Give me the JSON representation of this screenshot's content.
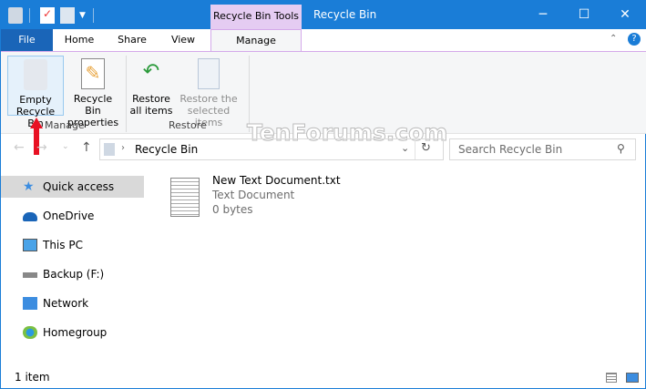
{
  "titlebar": {
    "context_tab": "Recycle Bin Tools",
    "title": "Recycle Bin",
    "minimize": "─",
    "maximize": "☐",
    "close": "✕"
  },
  "tabs": {
    "file": "File",
    "home": "Home",
    "share": "Share",
    "view": "View",
    "manage": "Manage"
  },
  "ribbon": {
    "empty_l1": "Empty",
    "empty_l2": "Recycle Bin",
    "props_l1": "Recycle Bin",
    "props_l2": "properties",
    "restore_all_l1": "Restore",
    "restore_all_l2": "all items",
    "restore_sel_l1": "Restore the",
    "restore_sel_l2": "selected items",
    "group_manage": "Manage",
    "group_restore": "Restore"
  },
  "address": {
    "path": "Recycle Bin",
    "search_placeholder": "Search Recycle Bin"
  },
  "watermark": "TenForums.com",
  "nav": [
    {
      "label": "Quick access"
    },
    {
      "label": "OneDrive"
    },
    {
      "label": "This PC"
    },
    {
      "label": "Backup (F:)"
    },
    {
      "label": "Network"
    },
    {
      "label": "Homegroup"
    }
  ],
  "file": {
    "name": "New Text Document.txt",
    "type": "Text Document",
    "size": "0 bytes"
  },
  "status": {
    "count": "1 item"
  },
  "colors": {
    "titlebar": "#1a7dd7",
    "context_tab": "#e5ccf2",
    "arrow": "#e81123"
  }
}
